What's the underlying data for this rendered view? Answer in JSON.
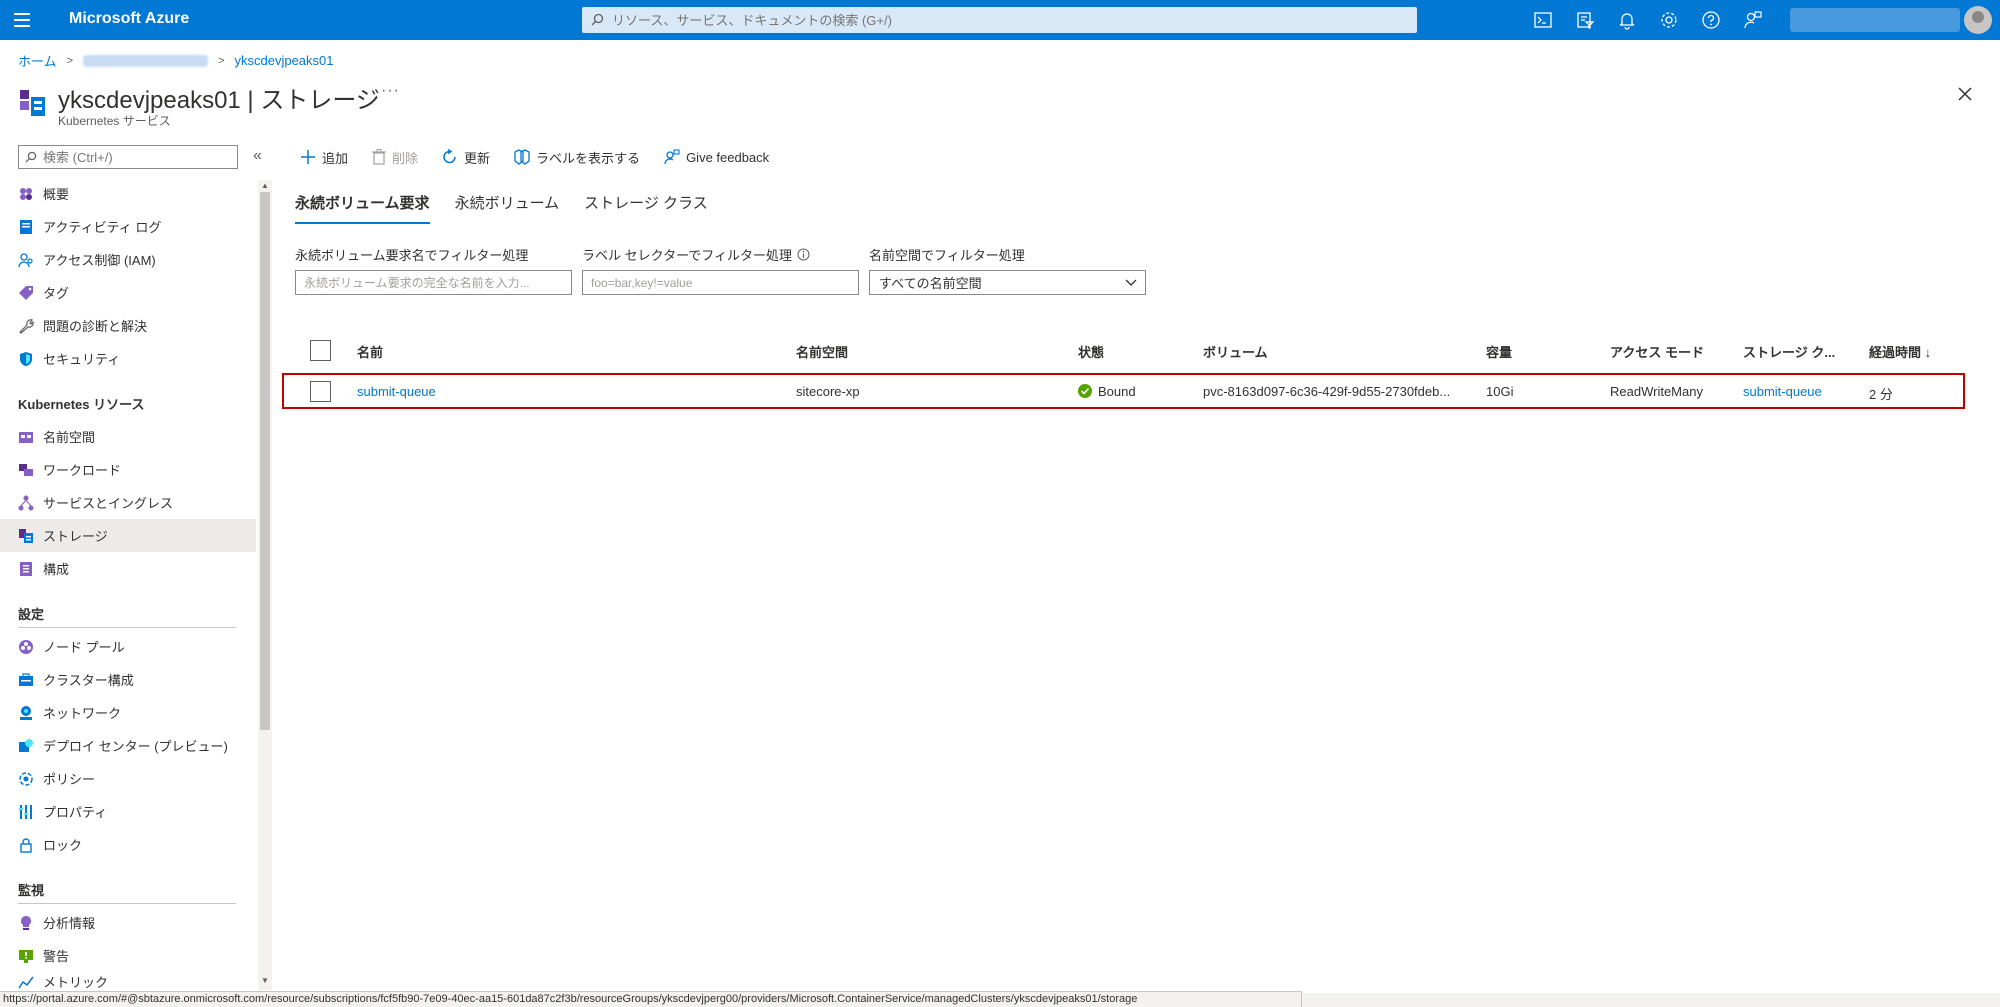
{
  "app": {
    "brand": "Microsoft Azure"
  },
  "search": {
    "placeholder": "リソース、サービス、ドキュメントの検索 (G+/)"
  },
  "topbar_icons": [
    "cloud-shell-icon",
    "directory-filter-icon",
    "notifications-icon",
    "settings-icon",
    "help-icon",
    "feedback-icon"
  ],
  "breadcrumb": {
    "home": "ホーム",
    "current": "ykscdevjpeaks01"
  },
  "header": {
    "title": "ykscdevjpeaks01 | ストレージ",
    "subtitle": "Kubernetes サービス",
    "more": "···"
  },
  "sidebar": {
    "search_placeholder": "検索 (Ctrl+/)",
    "collapse": "«",
    "items": [
      {
        "label": "概要",
        "icon": "overview-icon"
      },
      {
        "label": "アクティビティ ログ",
        "icon": "activity-log-icon"
      },
      {
        "label": "アクセス制御 (IAM)",
        "icon": "iam-icon"
      },
      {
        "label": "タグ",
        "icon": "tag-icon"
      },
      {
        "label": "問題の診断と解決",
        "icon": "wrench-icon"
      },
      {
        "label": "セキュリティ",
        "icon": "shield-icon"
      }
    ],
    "section_k8s": "Kubernetes リソース",
    "k8s_items": [
      {
        "label": "名前空間",
        "icon": "namespace-icon"
      },
      {
        "label": "ワークロード",
        "icon": "workload-icon"
      },
      {
        "label": "サービスとイングレス",
        "icon": "services-icon"
      },
      {
        "label": "ストレージ",
        "icon": "storage-icon"
      },
      {
        "label": "構成",
        "icon": "config-icon"
      }
    ],
    "section_settings": "設定",
    "settings_items": [
      {
        "label": "ノード プール",
        "icon": "node-pool-icon"
      },
      {
        "label": "クラスター構成",
        "icon": "cluster-config-icon"
      },
      {
        "label": "ネットワーク",
        "icon": "network-icon"
      },
      {
        "label": "デプロイ センター (プレビュー)",
        "icon": "deploy-center-icon"
      },
      {
        "label": "ポリシー",
        "icon": "policy-icon"
      },
      {
        "label": "プロパティ",
        "icon": "properties-icon"
      },
      {
        "label": "ロック",
        "icon": "lock-icon"
      }
    ],
    "section_monitoring": "監視",
    "monitoring_items": [
      {
        "label": "分析情報",
        "icon": "insights-icon"
      },
      {
        "label": "警告",
        "icon": "alert-icon"
      },
      {
        "label": "メトリック",
        "icon": "metrics-icon"
      }
    ]
  },
  "toolbar": {
    "add": "追加",
    "delete": "削除",
    "refresh": "更新",
    "show_labels": "ラベルを表示する",
    "feedback": "Give feedback"
  },
  "tabs": [
    "永続ボリューム要求",
    "永続ボリューム",
    "ストレージ クラス"
  ],
  "filters": {
    "name_label": "永続ボリューム要求名でフィルター処理",
    "name_placeholder": "永続ボリューム要求の完全な名前を入力...",
    "label_label": "ラベル セレクターでフィルター処理",
    "label_placeholder": "foo=bar,key!=value",
    "namespace_label": "名前空間でフィルター処理",
    "namespace_value": "すべての名前空間"
  },
  "table": {
    "columns": [
      "名前",
      "名前空間",
      "状態",
      "ボリューム",
      "容量",
      "アクセス モード",
      "ストレージ ク...",
      "経過時間 ↓"
    ],
    "rows": [
      {
        "name": "submit-queue",
        "namespace": "sitecore-xp",
        "status": "Bound",
        "volume": "pvc-8163d097-6c36-429f-9d55-2730fdeb...",
        "capacity": "10Gi",
        "access_mode": "ReadWriteMany",
        "storage_class": "submit-queue",
        "age": "2 分"
      }
    ]
  },
  "statusbar": {
    "url": "https://portal.azure.com/#@sbtazure.onmicrosoft.com/resource/subscriptions/fcf5fb90-7e09-40ec-aa15-601da87c2f3b/resourceGroups/ykscdevjperg00/providers/Microsoft.ContainerService/managedClusters/ykscdevjpeaks01/storage"
  },
  "colors": {
    "azure_blue": "#0078d4",
    "highlight_border": "#c00000",
    "status_ok": "#57a300"
  }
}
